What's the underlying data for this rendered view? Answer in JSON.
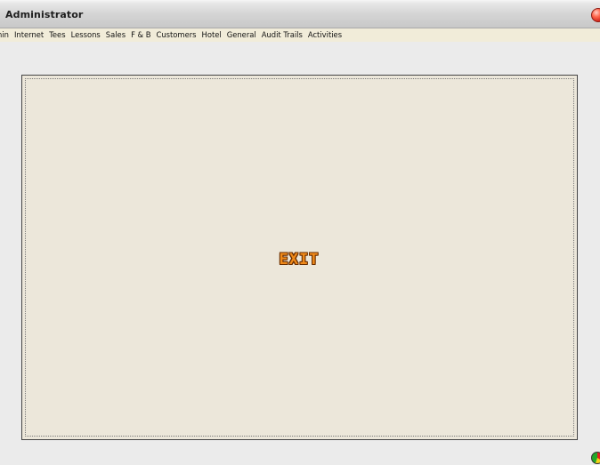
{
  "window": {
    "title": "Administrator"
  },
  "menu": {
    "items": [
      {
        "label": "nin"
      },
      {
        "label": "Internet"
      },
      {
        "label": "Tees"
      },
      {
        "label": "Lessons"
      },
      {
        "label": "Sales"
      },
      {
        "label": "F & B"
      },
      {
        "label": "Customers"
      },
      {
        "label": "Hotel"
      },
      {
        "label": "General"
      },
      {
        "label": "Audit Trails"
      },
      {
        "label": "Activities"
      }
    ]
  },
  "main": {
    "exit_label": "EXIT"
  },
  "icons": {
    "close": "close-icon",
    "status": "status-indicator-icon"
  },
  "colors": {
    "menubar": "#f1ecd9",
    "panel": "#ece7da",
    "exit_text": "#f08a1a",
    "exit_outline": "#6a2e00"
  }
}
